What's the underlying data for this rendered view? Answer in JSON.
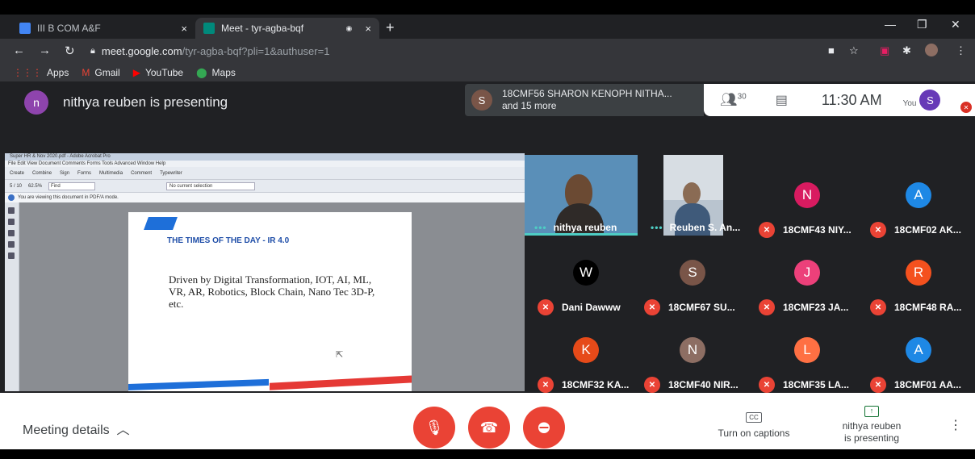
{
  "browser": {
    "tabs": [
      {
        "title": "III B COM A&F",
        "close": "×"
      },
      {
        "title": "Meet - tyr-agba-bqf",
        "recording": "◉",
        "close": "×"
      }
    ],
    "new_tab": "+",
    "window_controls": {
      "minimize": "—",
      "maximize": "❐",
      "close": "✕"
    },
    "url_host": "meet.google.com",
    "url_path": "/tyr-agba-bqf?pli=1&authuser=1",
    "bookmarks": [
      {
        "label": "Apps",
        "icon": "apps-icon"
      },
      {
        "label": "Gmail",
        "icon": "gmail-icon"
      },
      {
        "label": "YouTube",
        "icon": "youtube-icon"
      },
      {
        "label": "Maps",
        "icon": "maps-icon"
      }
    ]
  },
  "meet": {
    "presenter_initial": "n",
    "presenter_banner": "nithya reuben is presenting",
    "speaker_initial": "S",
    "speaker_name": "18CMF56 SHARON KENOPH NITHA...",
    "speaker_more": "and 15 more",
    "participant_count": "30",
    "time": "11:30 AM",
    "you_label": "You",
    "you_initial": "S",
    "shared_screen": {
      "window_title": "Super HR & Nov 2020.pdf - Adobe Acrobat Pro",
      "menu": "File  Edit  View  Document  Comments  Forms  Tools  Advanced  Window  Help",
      "toolbar1": [
        "Create",
        "Combine",
        "Sign",
        "Forms",
        "Multimedia",
        "Comment",
        "Typewriter"
      ],
      "page_nav": "5  / 10",
      "zoom": "62.5%",
      "find": "Find",
      "no_selection": "No current selection",
      "info_bar": "You are viewing this document in PDF/A mode.",
      "slide_title": "THE TIMES OF THE DAY - IR 4.0",
      "slide_body": "Driven by Digital Transformation, IOT, AI, ML, VR, AR, Robotics, Block Chain, Nano Tec 3D-P, etc."
    },
    "tiles": [
      {
        "name": "nithya reuben",
        "video": true
      },
      {
        "name": "Reuben S. An...",
        "video": true
      },
      {
        "name": "18CMF43 NIY...",
        "initial": "N",
        "color": "#d81b60"
      },
      {
        "name": "18CMF02 AK...",
        "initial": "A",
        "color": "#1e88e5"
      },
      {
        "name": "Dani Dawww",
        "initial": "W",
        "color": "#000000"
      },
      {
        "name": "18CMF67 SU...",
        "initial": "S",
        "color": "#795548"
      },
      {
        "name": "18CMF23 JA...",
        "initial": "J",
        "color": "#ec407a"
      },
      {
        "name": "18CMF48 RA...",
        "initial": "R",
        "color": "#f4511e"
      },
      {
        "name": "18CMF32 KA...",
        "initial": "K",
        "color": "#e64a19"
      },
      {
        "name": "18CMF40 NIR...",
        "initial": "N",
        "color": "#8d6e63"
      },
      {
        "name": "18CMF35 LA...",
        "initial": "L",
        "color": "#ff7043"
      },
      {
        "name": "18CMF01 AA...",
        "initial": "A",
        "color": "#1e88e5"
      }
    ],
    "bottom": {
      "meeting_details": "Meeting details",
      "captions": "Turn on captions",
      "captions_icon": "CC",
      "presenting_line1": "nithya reuben",
      "presenting_line2": "is presenting"
    }
  }
}
